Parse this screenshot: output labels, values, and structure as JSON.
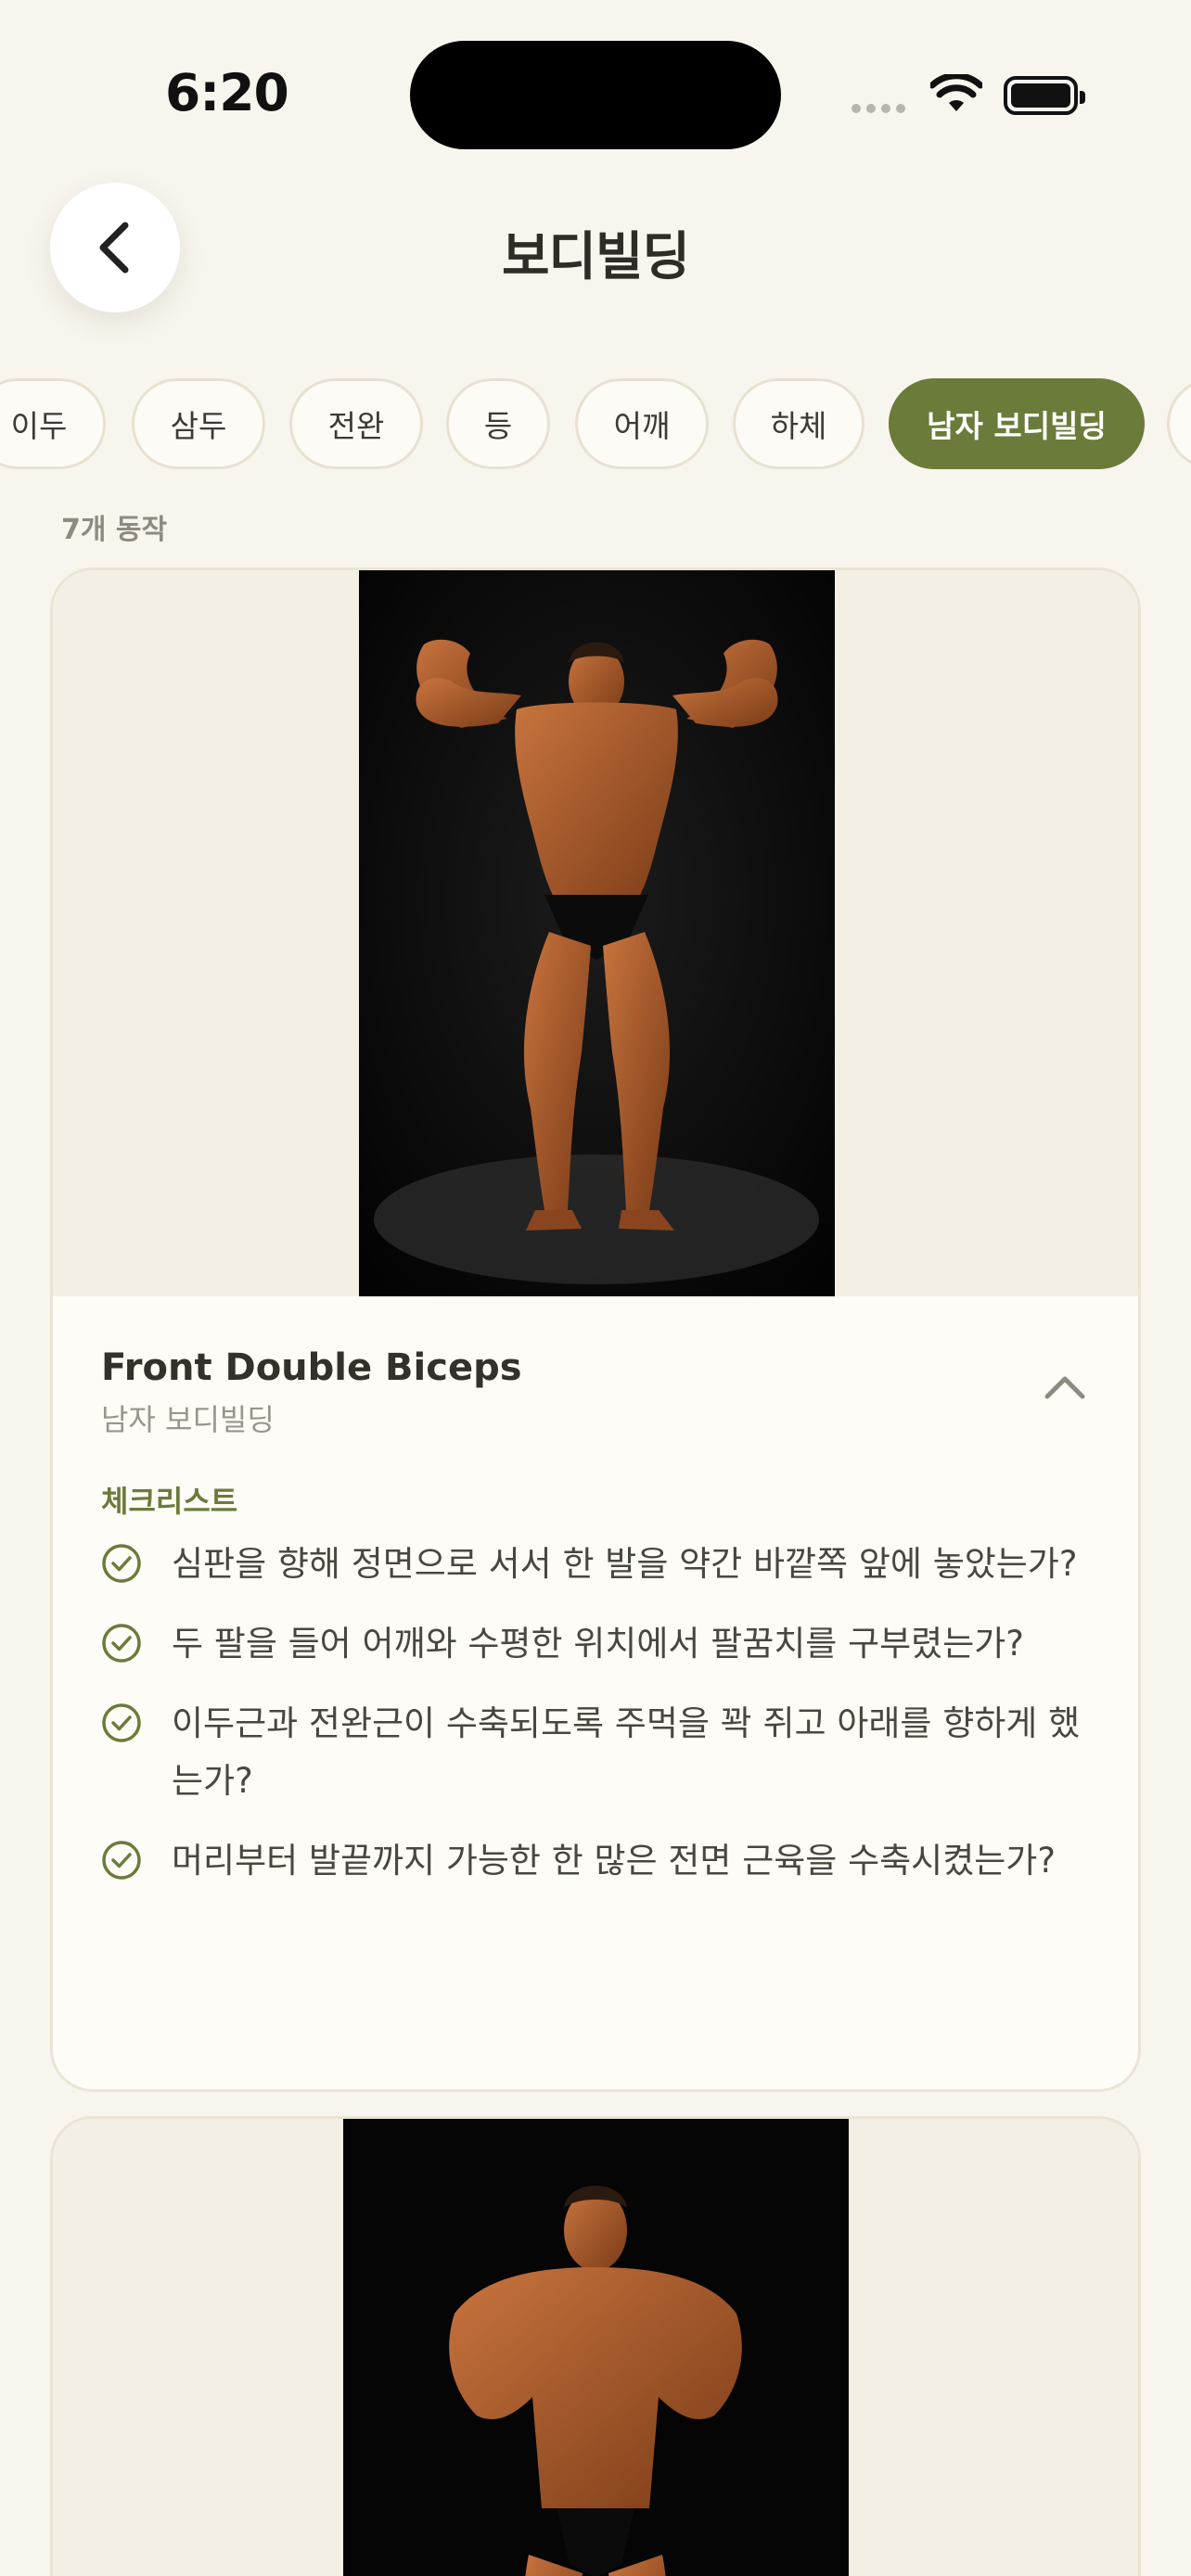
{
  "status_bar": {
    "time": "6:20"
  },
  "header": {
    "title": "보디빌딩",
    "back_icon": "chevron-left-icon"
  },
  "categories": [
    {
      "label": "이두",
      "active": false
    },
    {
      "label": "삼두",
      "active": false
    },
    {
      "label": "전완",
      "active": false
    },
    {
      "label": "등",
      "active": false
    },
    {
      "label": "어깨",
      "active": false
    },
    {
      "label": "하체",
      "active": false
    },
    {
      "label": "남자 보디빌딩",
      "active": true
    },
    {
      "label": "",
      "active": false
    }
  ],
  "count_label": "7개 동작",
  "cards": [
    {
      "name": "Front Double Biceps",
      "category": "남자 보디빌딩",
      "expanded": true,
      "checklist_title": "체크리스트",
      "checklist": [
        "심판을 향해 정면으로 서서 한 발을 약간 바깥쪽 앞에 놓았는가?",
        "두 팔을 들어 어깨와 수평한 위치에서 팔꿈치를 구부렸는가?",
        "이두근과 전완근이 수축되도록 주먹을 꽉 쥐고 아래를 향하게 했는가?",
        "머리부터 발끝까지 가능한 한 많은 전면 근육을 수축시켰는가?"
      ]
    }
  ],
  "colors": {
    "accent": "#6b7b3a",
    "background": "#f8f5ee",
    "card": "#fdfcf7",
    "chip_border": "#e9e1d0"
  }
}
